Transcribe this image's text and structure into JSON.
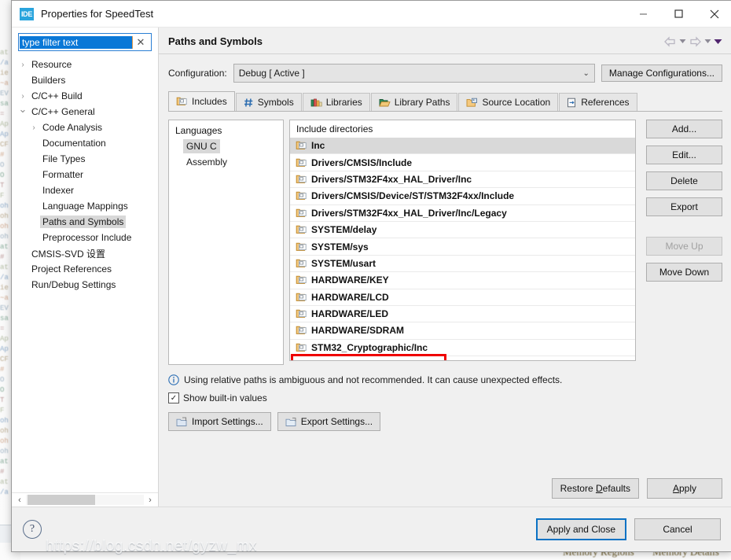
{
  "window": {
    "title": "Properties for SpeedTest",
    "logo_text": "IDE",
    "minimize": "minimize-icon",
    "maximize": "maximize-icon",
    "close": "close-icon"
  },
  "sidebar": {
    "filter": {
      "value": "type filter text",
      "placeholder": "type filter text",
      "clear": "✕"
    },
    "items": [
      {
        "label": "Resource",
        "indent": 0,
        "arrow": "›",
        "selected": false
      },
      {
        "label": "Builders",
        "indent": 0,
        "arrow": "",
        "selected": false
      },
      {
        "label": "C/C++ Build",
        "indent": 0,
        "arrow": "›",
        "selected": false
      },
      {
        "label": "C/C++ General",
        "indent": 0,
        "arrow": "⌄",
        "selected": false
      },
      {
        "label": "Code Analysis",
        "indent": 1,
        "arrow": "›",
        "selected": false
      },
      {
        "label": "Documentation",
        "indent": 1,
        "arrow": "",
        "selected": false
      },
      {
        "label": "File Types",
        "indent": 1,
        "arrow": "",
        "selected": false
      },
      {
        "label": "Formatter",
        "indent": 1,
        "arrow": "",
        "selected": false
      },
      {
        "label": "Indexer",
        "indent": 1,
        "arrow": "",
        "selected": false
      },
      {
        "label": "Language Mappings",
        "indent": 1,
        "arrow": "",
        "selected": false
      },
      {
        "label": "Paths and Symbols",
        "indent": 1,
        "arrow": "",
        "selected": true
      },
      {
        "label": "Preprocessor Include",
        "indent": 1,
        "arrow": "",
        "selected": false
      },
      {
        "label": "CMSIS-SVD 设置",
        "indent": 0,
        "arrow": "",
        "selected": false
      },
      {
        "label": "Project References",
        "indent": 0,
        "arrow": "",
        "selected": false
      },
      {
        "label": "Run/Debug Settings",
        "indent": 0,
        "arrow": "",
        "selected": false
      }
    ]
  },
  "pane": {
    "title": "Paths and Symbols",
    "nav": {
      "back": "back-arrow-icon",
      "back_menu": "chevron-down-icon",
      "forward": "forward-arrow-icon",
      "forward_menu": "chevron-down-icon",
      "view_menu": "view-menu-icon"
    }
  },
  "configuration": {
    "label": "Configuration:",
    "value": "Debug  [ Active ]",
    "manage_button": "Manage Configurations..."
  },
  "tabs": [
    {
      "label": "Includes",
      "icon": "include-folder-icon",
      "active": true
    },
    {
      "label": "Symbols",
      "icon": "hash-icon",
      "active": false
    },
    {
      "label": "Libraries",
      "icon": "books-icon",
      "active": false
    },
    {
      "label": "Library Paths",
      "icon": "open-folder-icon",
      "active": false
    },
    {
      "label": "Source Location",
      "icon": "source-folder-icon",
      "active": false
    },
    {
      "label": "References",
      "icon": "reference-icon",
      "active": false
    }
  ],
  "languages": {
    "header": "Languages",
    "items": [
      {
        "label": "GNU C",
        "selected": true
      },
      {
        "label": "Assembly",
        "selected": false
      }
    ]
  },
  "include_directories": {
    "header": "Include directories",
    "items": [
      {
        "path": "Inc",
        "selected": true,
        "highlighted": false
      },
      {
        "path": "Drivers/CMSIS/Include",
        "selected": false,
        "highlighted": false
      },
      {
        "path": "Drivers/STM32F4xx_HAL_Driver/Inc",
        "selected": false,
        "highlighted": false
      },
      {
        "path": "Drivers/CMSIS/Device/ST/STM32F4xx/Include",
        "selected": false,
        "highlighted": false
      },
      {
        "path": "Drivers/STM32F4xx_HAL_Driver/Inc/Legacy",
        "selected": false,
        "highlighted": false
      },
      {
        "path": "SYSTEM/delay",
        "selected": false,
        "highlighted": false
      },
      {
        "path": "SYSTEM/sys",
        "selected": false,
        "highlighted": false
      },
      {
        "path": "SYSTEM/usart",
        "selected": false,
        "highlighted": false
      },
      {
        "path": "HARDWARE/KEY",
        "selected": false,
        "highlighted": false
      },
      {
        "path": "HARDWARE/LCD",
        "selected": false,
        "highlighted": false
      },
      {
        "path": "HARDWARE/LED",
        "selected": false,
        "highlighted": false
      },
      {
        "path": "HARDWARE/SDRAM",
        "selected": false,
        "highlighted": false
      },
      {
        "path": "STM32_Cryptographic/Inc",
        "selected": false,
        "highlighted": true
      }
    ]
  },
  "list_buttons": [
    {
      "label": "Add...",
      "disabled": false
    },
    {
      "label": "Edit...",
      "disabled": false
    },
    {
      "label": "Delete",
      "disabled": false
    },
    {
      "label": "Export",
      "disabled": false
    },
    {
      "label": "Move Up",
      "disabled": true
    },
    {
      "label": "Move Down",
      "disabled": false
    }
  ],
  "info": {
    "icon": "info-icon",
    "text": "Using relative paths is ambiguous and not recommended. It can cause unexpected effects."
  },
  "show_builtin": {
    "label": "Show built-in values",
    "checked": true,
    "mark": "✓"
  },
  "settings_buttons": [
    {
      "label": "Import Settings...",
      "icon": "import-icon"
    },
    {
      "label": "Export Settings...",
      "icon": "export-icon"
    }
  ],
  "pane_buttons": [
    {
      "label_pre": "Restore ",
      "mnemonic": "D",
      "label_post": "efaults"
    },
    {
      "label_pre": "",
      "mnemonic": "A",
      "label_post": "pply"
    }
  ],
  "dialog_buttons": {
    "help": "help-icon",
    "apply_and_close": "Apply and Close",
    "cancel": "Cancel"
  },
  "annotation": {
    "color": "#ef0000",
    "target": "STM32_Cryptographic/Inc"
  },
  "background": {
    "watermark": "https://blog.csdn.net/gyzw_mx",
    "status_left": "Memory Regions",
    "status_right": "Memory Details"
  },
  "colors": {
    "accent": "#0a72c4",
    "selection": "#0a78d7",
    "annotation": "#ef0000",
    "logo": "#29a4dd"
  }
}
